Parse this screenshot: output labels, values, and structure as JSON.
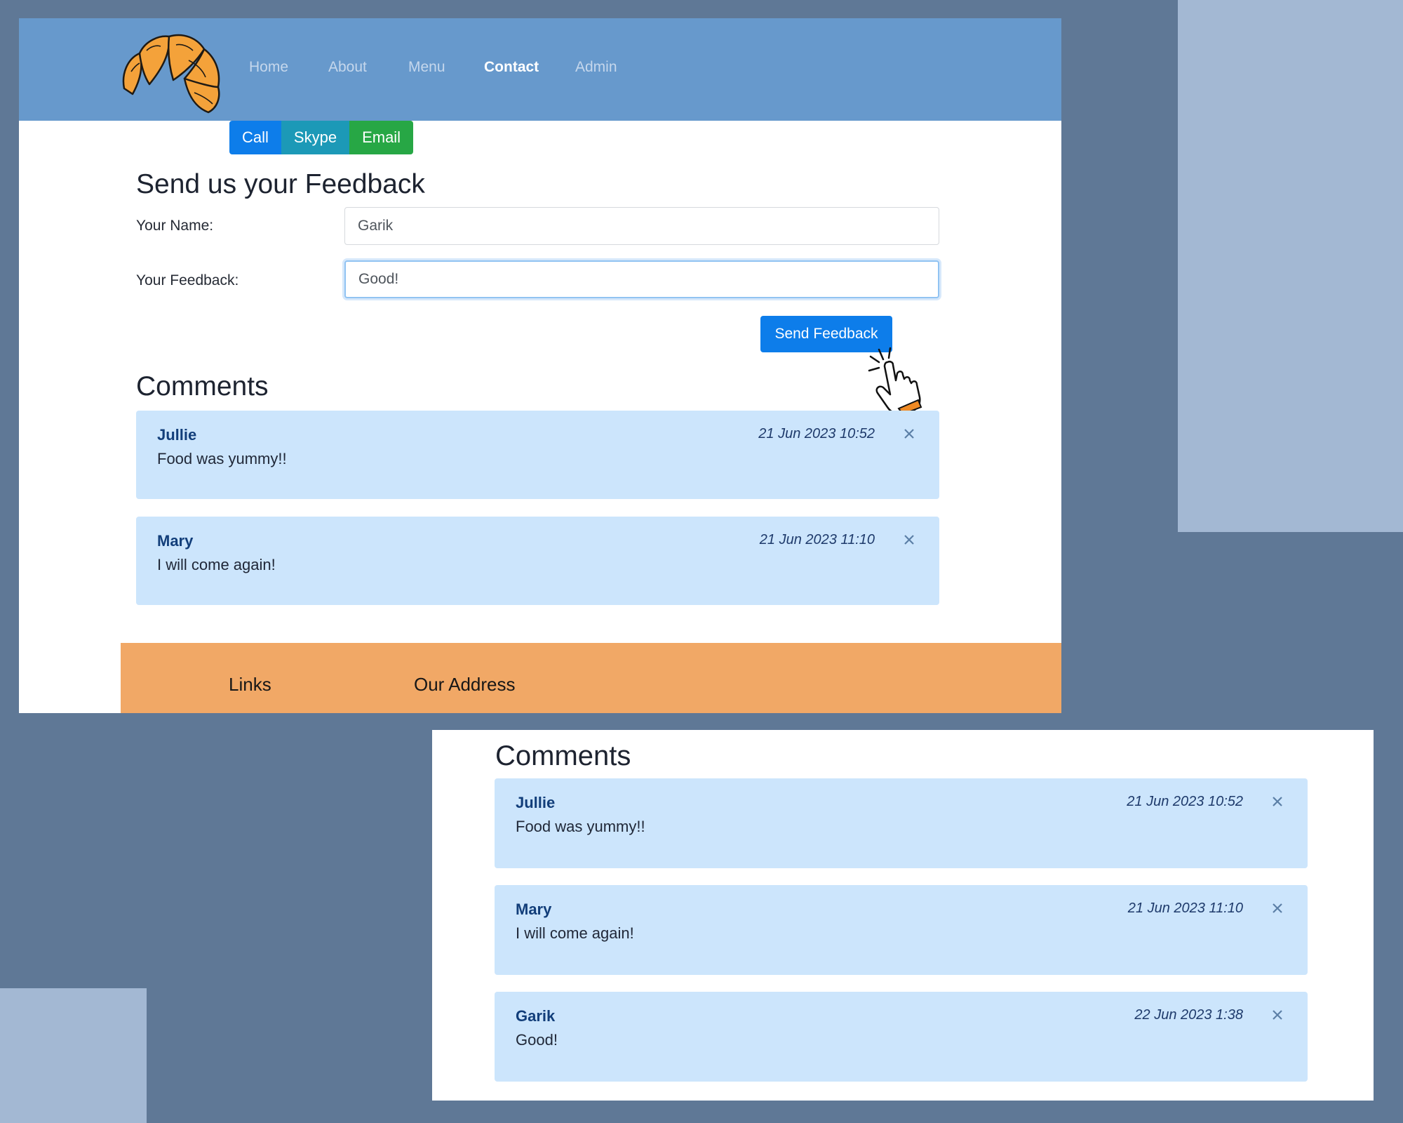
{
  "nav": {
    "links": [
      "Home",
      "About",
      "Menu",
      "Contact",
      "Admin"
    ]
  },
  "contact_buttons": {
    "call": "Call",
    "skype": "Skype",
    "email": "Email"
  },
  "feedback_form": {
    "heading": "Send us your Feedback",
    "name_label": "Your Name:",
    "name_value": "Garik",
    "feedback_label": "Your Feedback:",
    "feedback_value": "Good!",
    "submit_label": "Send Feedback"
  },
  "comments_heading": "Comments",
  "comments_before": [
    {
      "author": "Jullie",
      "text": "Food was yummy!!",
      "date": "21 Jun 2023 10:52"
    },
    {
      "author": "Mary",
      "text": "I will come again!",
      "date": "21 Jun 2023 11:10"
    }
  ],
  "comments_after": [
    {
      "author": "Jullie",
      "text": "Food was yummy!!",
      "date": "21 Jun 2023 10:52"
    },
    {
      "author": "Mary",
      "text": "I will come again!",
      "date": "21 Jun 2023 11:10"
    },
    {
      "author": "Garik",
      "text": "Good!",
      "date": "22 Jun 2023 1:38"
    }
  ],
  "footer": {
    "links_heading": "Links",
    "address_heading": "Our Address"
  },
  "colors": {
    "navbar": "#6799cc",
    "primary": "#0d7dea",
    "skype": "#1c99b7",
    "email": "#27a745",
    "comment_bg": "#cce5fc",
    "footer": "#f1a866",
    "backdrop": "#5f7896"
  },
  "icons": {
    "logo": "croissant-logo",
    "close": "close-icon",
    "cursor": "pointer-hand-cursor"
  }
}
